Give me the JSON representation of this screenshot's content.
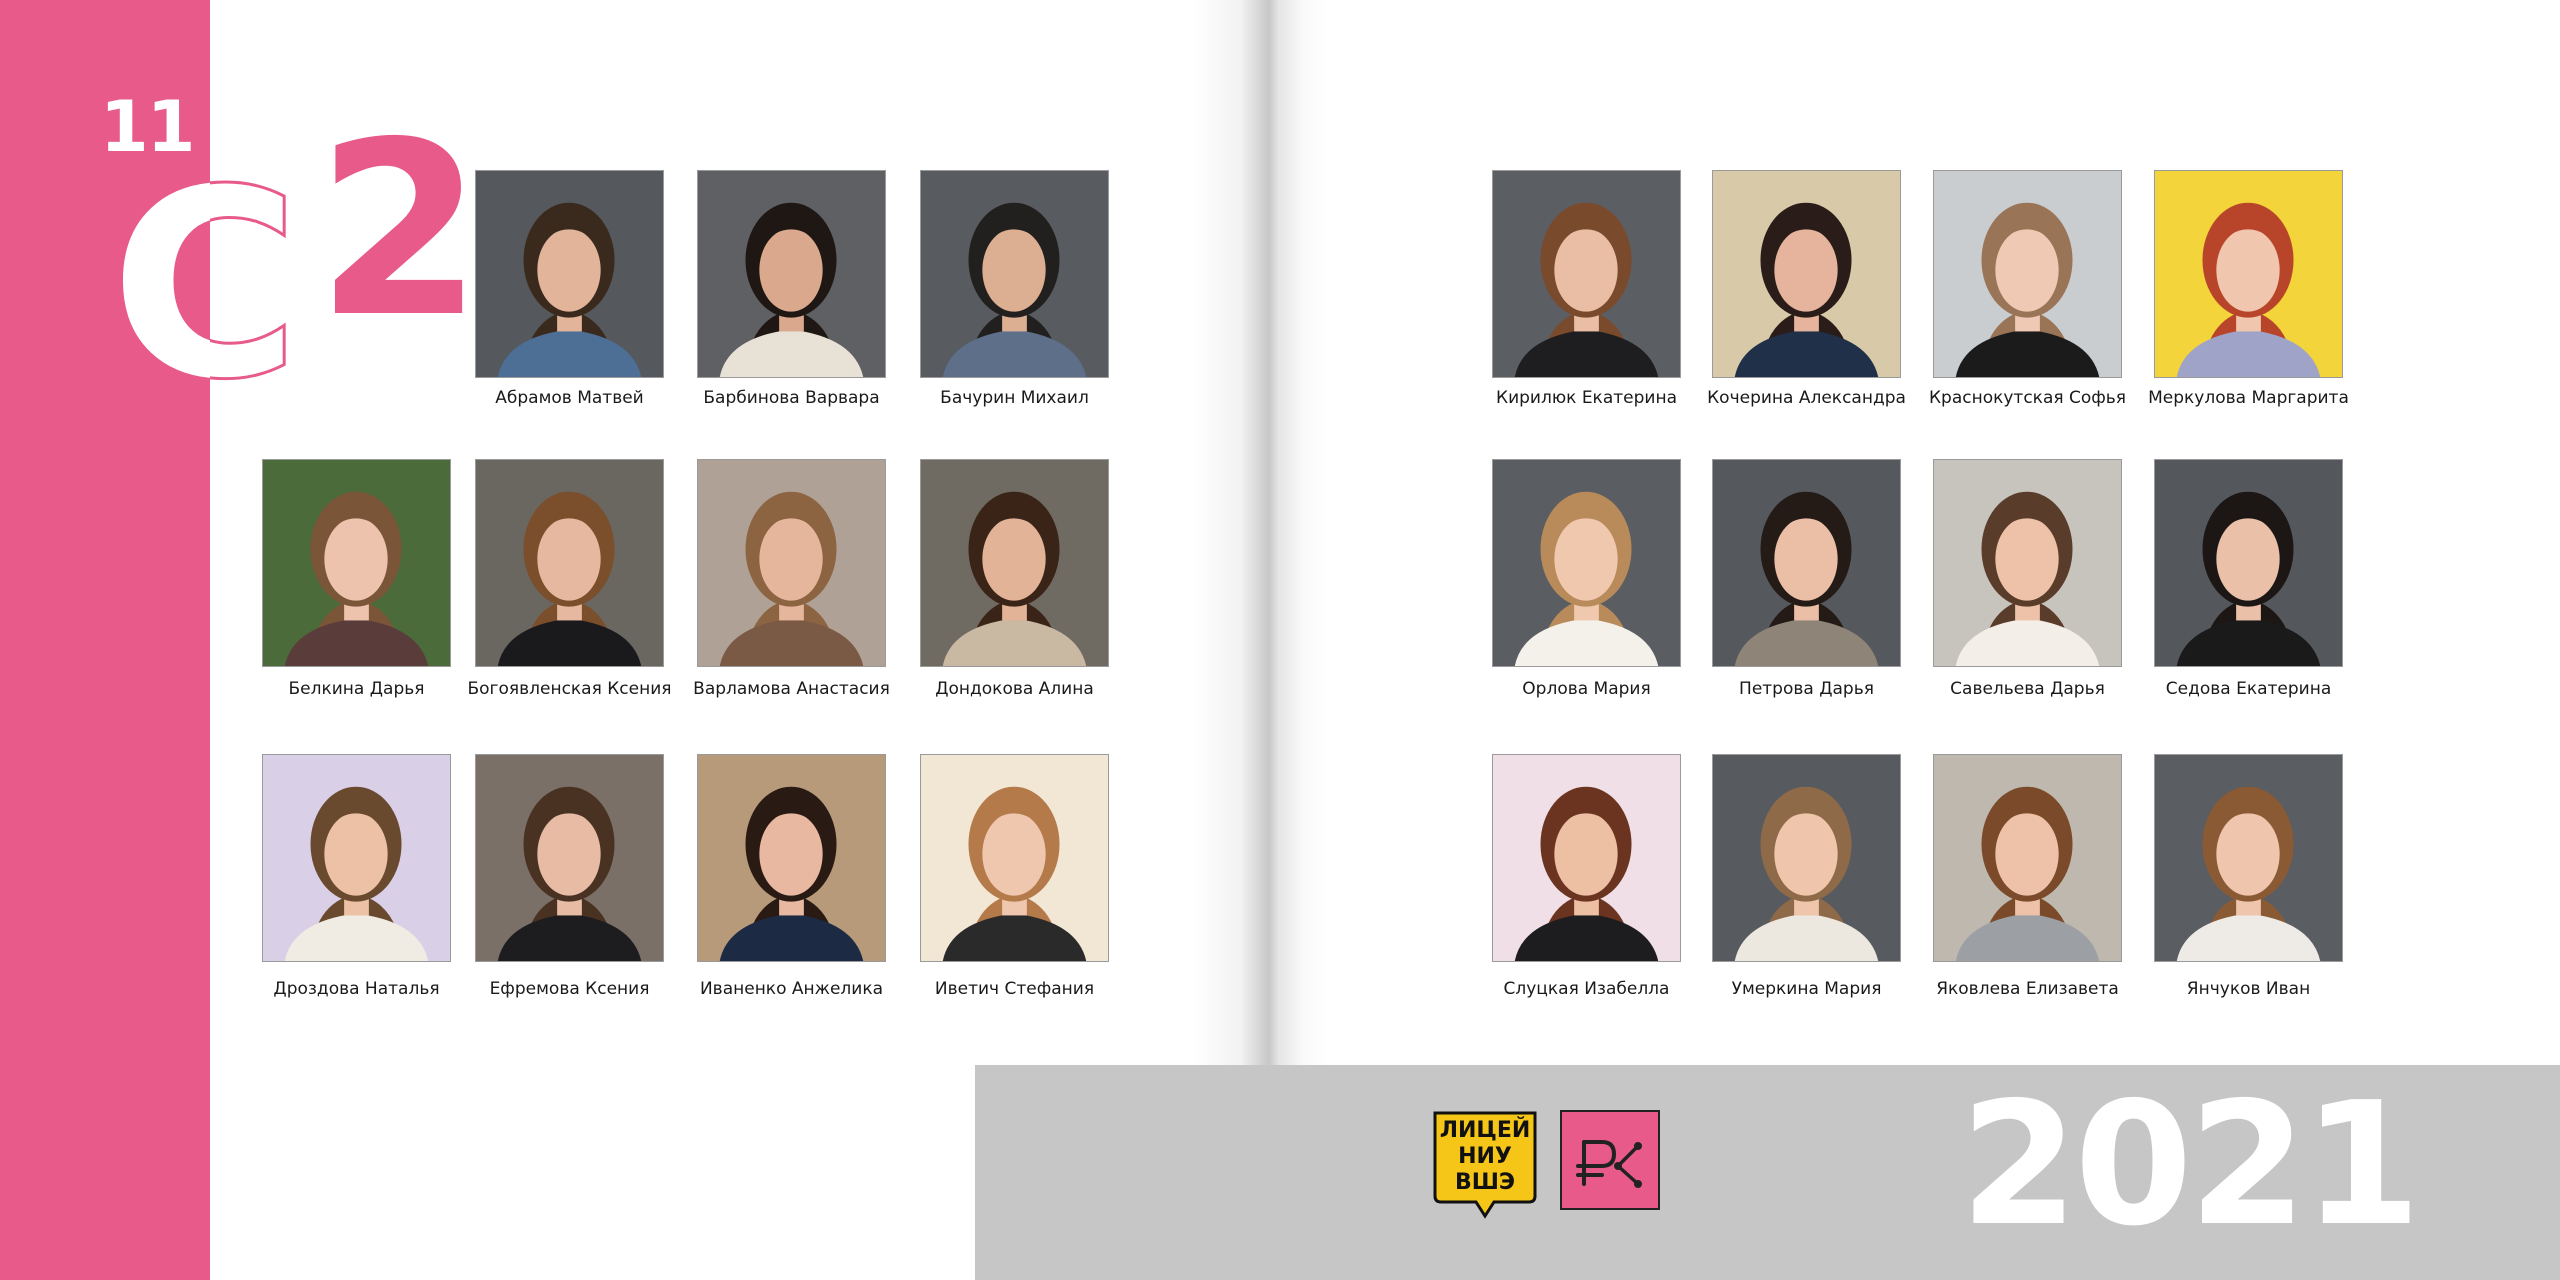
{
  "header": {
    "grade": "11",
    "class_letter": "С",
    "class_number": "2"
  },
  "left_page": {
    "students": [
      {
        "name": "Абрамов Матвей",
        "bg": "#55585c",
        "hair": "#3a2a1e",
        "skin": "#e2b59a",
        "cloth": "#4d6f96"
      },
      {
        "name": "Барбинова Варвара",
        "bg": "#5e6064",
        "hair": "#1f1713",
        "skin": "#d9a88d",
        "cloth": "#e8e2d6"
      },
      {
        "name": "Бачурин Михаил",
        "bg": "#585b60",
        "hair": "#22201e",
        "skin": "#dcae92",
        "cloth": "#5e6f8a"
      },
      {
        "name": "Белкина Дарья",
        "bg": "#4c6b3a",
        "hair": "#7a5538",
        "skin": "#edc3ad",
        "cloth": "#5a3c3a"
      },
      {
        "name": "Богоявленская Ксения",
        "bg": "#6a6660",
        "hair": "#7b4e2c",
        "skin": "#e6b8a0",
        "cloth": "#1a1a1c"
      },
      {
        "name": "Варламова Анастасия",
        "bg": "#b0a196",
        "hair": "#8c6441",
        "skin": "#e5b69c",
        "cloth": "#7b5a45"
      },
      {
        "name": "Дондокова Алина",
        "bg": "#6f6a62",
        "hair": "#3a2418",
        "skin": "#e2b397",
        "cloth": "#c9b8a2"
      },
      {
        "name": "Дроздова Наталья",
        "bg": "#d9d0e8",
        "hair": "#6a4a2e",
        "skin": "#edc1a6",
        "cloth": "#f0ece3"
      },
      {
        "name": "Ефремова Ксения",
        "bg": "#7a7068",
        "hair": "#4a3222",
        "skin": "#e8bca4",
        "cloth": "#1d1d1f"
      },
      {
        "name": "Иваненко Анжелика",
        "bg": "#b69a7a",
        "hair": "#2a1a14",
        "skin": "#e8b9a0",
        "cloth": "#1d2a44"
      },
      {
        "name": "Иветич Стефания",
        "bg": "#f2e6d4",
        "hair": "#b57a4a",
        "skin": "#efc6ae",
        "cloth": "#2a2a2a"
      }
    ]
  },
  "right_page": {
    "students": [
      {
        "name": "Кирилюк Екатерина",
        "bg": "#5b5e63",
        "hair": "#7a4a2c",
        "skin": "#e9bea5",
        "cloth": "#1e1e20"
      },
      {
        "name": "Кочерина Александра",
        "bg": "#d8c9a8",
        "hair": "#2a1c18",
        "skin": "#e6b49c",
        "cloth": "#203048"
      },
      {
        "name": "Краснокутская Софья",
        "bg": "#c9cdd0",
        "hair": "#9a7456",
        "skin": "#efc9b3",
        "cloth": "#1b1b1c"
      },
      {
        "name": "Меркулова Маргарита",
        "bg": "#f3d43a",
        "hair": "#b8452a",
        "skin": "#f0c7ae",
        "cloth": "#9fa3c8"
      },
      {
        "name": "Орлова Мария",
        "bg": "#5a5d62",
        "hair": "#b98a5a",
        "skin": "#f0c8ae",
        "cloth": "#f4f1ea"
      },
      {
        "name": "Петрова Дарья",
        "bg": "#55585d",
        "hair": "#241a16",
        "skin": "#ebbea6",
        "cloth": "#8e8578"
      },
      {
        "name": "Савельева Дарья",
        "bg": "#c7c3bd",
        "hair": "#5a3c2a",
        "skin": "#edc2a9",
        "cloth": "#f3efe8"
      },
      {
        "name": "Седова Екатерина",
        "bg": "#54575c",
        "hair": "#1c1614",
        "skin": "#ebc0a8",
        "cloth": "#1a1a1b"
      },
      {
        "name": "Слуцкая Изабелла",
        "bg": "#f0dfe6",
        "hair": "#6a3420",
        "skin": "#edbfa3",
        "cloth": "#1d1d1f"
      },
      {
        "name": "Умеркина Мария",
        "bg": "#575a5f",
        "hair": "#8f6a48",
        "skin": "#efc5ab",
        "cloth": "#ece8e0"
      },
      {
        "name": "Яковлева Елизавета",
        "bg": "#bfb8ae",
        "hair": "#7a4a2a",
        "skin": "#eec2a8",
        "cloth": "#9c9fa4"
      },
      {
        "name": "Янчуков Иван",
        "bg": "#5a5d62",
        "hair": "#8a5a34",
        "skin": "#efc6ad",
        "cloth": "#eeebe6"
      }
    ]
  },
  "footer": {
    "lyceum_logo_lines": [
      "ЛИЦЕЙ",
      "НИУ",
      "ВШЭ"
    ],
    "year": "2021"
  },
  "colors": {
    "accent_pink": "#e85a8a",
    "footer_band": "#c6c6c6",
    "logo_yellow": "#f5c518"
  }
}
